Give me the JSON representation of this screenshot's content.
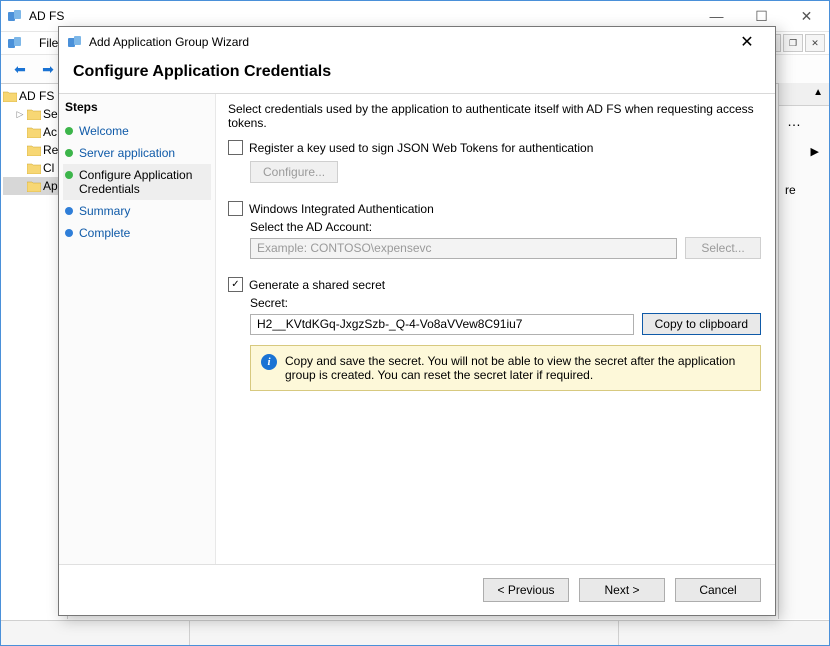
{
  "main_window": {
    "title": "AD FS",
    "menu": {
      "file": "File"
    },
    "tree": {
      "root": "AD FS",
      "children": [
        "Se",
        "Ac",
        "Re",
        "Cl",
        "Ap"
      ]
    },
    "actions_pane": {
      "re": "re"
    }
  },
  "wizard": {
    "title": "Add Application Group Wizard",
    "header": "Configure Application Credentials",
    "steps_title": "Steps",
    "steps": [
      {
        "label": "Welcome",
        "state": "done"
      },
      {
        "label": "Server application",
        "state": "done"
      },
      {
        "label": "Configure Application Credentials",
        "state": "current"
      },
      {
        "label": "Summary",
        "state": "todo"
      },
      {
        "label": "Complete",
        "state": "todo"
      }
    ],
    "description": "Select credentials used by the application to authenticate itself with AD FS when requesting access tokens.",
    "register_key": {
      "checked": false,
      "label": "Register a key used to sign JSON Web Tokens for authentication",
      "configure_btn": "Configure..."
    },
    "wia": {
      "checked": false,
      "label": "Windows Integrated Authentication",
      "account_label": "Select the AD Account:",
      "placeholder": "Example: CONTOSO\\expensevc",
      "select_btn": "Select..."
    },
    "secret": {
      "checked": true,
      "label": "Generate a shared secret",
      "field_label": "Secret:",
      "value": "H2__KVtdKGq-JxgzSzb-_Q-4-Vo8aVVew8C91iu7",
      "copy_btn": "Copy to clipboard",
      "info": "Copy and save the secret.  You will not be able to view the secret after the application group is created.  You can reset the secret later if required."
    },
    "buttons": {
      "previous": "< Previous",
      "next": "Next >",
      "cancel": "Cancel"
    }
  }
}
